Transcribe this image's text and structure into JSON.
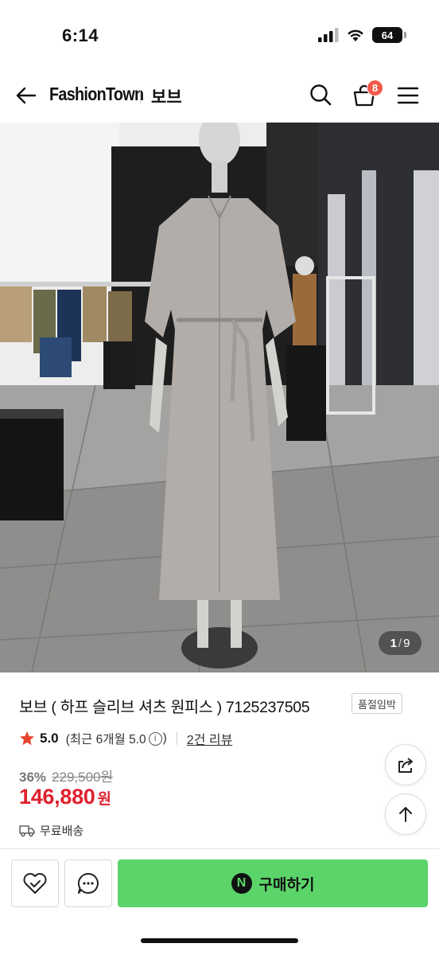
{
  "status": {
    "time": "6:14",
    "battery": "64"
  },
  "header": {
    "brand": "FashionTown",
    "shop": "보브",
    "cart_count": "8"
  },
  "gallery": {
    "current": "1",
    "separator": "/",
    "total": "9"
  },
  "product": {
    "title": "보브 ( 하프 슬리브 셔츠 원피스 ) 7125237505",
    "badge": "품절임박",
    "rating": "5.0",
    "rating_recent": "(최근 6개월 5.0",
    "rating_paren_close": ")",
    "review_link": "2건 리뷰",
    "discount_rate": "36%",
    "original_price": "229,500원",
    "price": "146,880",
    "currency": "원",
    "shipping": "무료배송"
  },
  "bottom_bar": {
    "buy_label": "구매하기",
    "npay_letter": "N"
  },
  "colors": {
    "accent_green": "#5bd46a",
    "price_red": "#e0212f",
    "badge_red": "#f25a4a",
    "star": "#e8452f"
  },
  "icons": [
    "back-arrow-icon",
    "search-icon",
    "cart-icon",
    "menu-icon",
    "star-icon",
    "info-icon",
    "truck-icon",
    "share-icon",
    "arrow-up-icon",
    "heart-icon",
    "chat-icon",
    "naver-pay-icon"
  ]
}
